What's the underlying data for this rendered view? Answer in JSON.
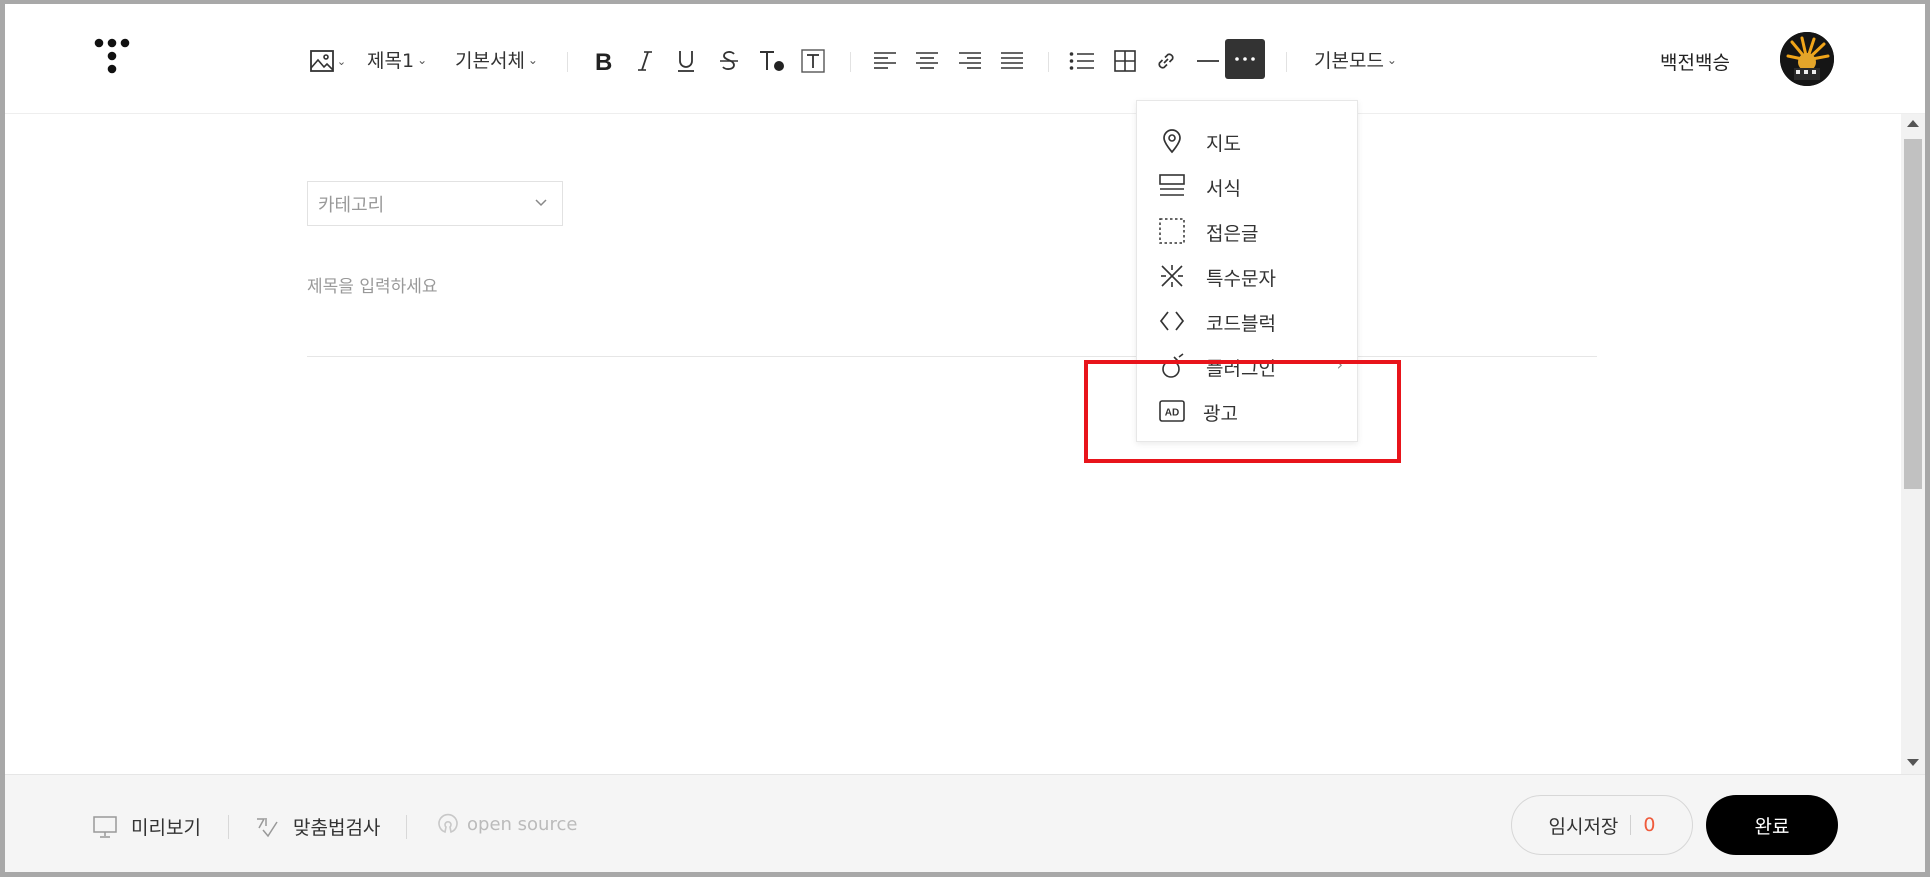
{
  "toolbar": {
    "heading_label": "제목1",
    "font_label": "기본서체",
    "mode_label": "기본모드",
    "user_name": "백전백승"
  },
  "editor": {
    "category_placeholder": "카테고리",
    "title_placeholder": "제목을 입력하세요"
  },
  "more_menu": {
    "items": [
      {
        "label": "지도",
        "icon": "map-pin-icon"
      },
      {
        "label": "서식",
        "icon": "template-icon"
      },
      {
        "label": "접은글",
        "icon": "fold-box-icon"
      },
      {
        "label": "특수문자",
        "icon": "special-char-icon"
      },
      {
        "label": "코드블럭",
        "icon": "code-block-icon"
      },
      {
        "label": "플러그인",
        "icon": "plugin-icon",
        "has_submenu": true
      },
      {
        "label": "광고",
        "icon": "ad-icon"
      }
    ]
  },
  "footer": {
    "preview_label": "미리보기",
    "spellcheck_label": "맞춤법검사",
    "opensource_label": "open source",
    "save_label": "임시저장",
    "save_count": "0",
    "done_label": "완료"
  },
  "colors": {
    "highlight": "#e8141b",
    "save_count": "#ef5b3c",
    "done_bg": "#000000",
    "more_btn_bg": "#333333"
  }
}
